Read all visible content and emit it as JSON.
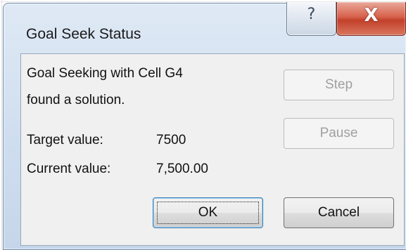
{
  "dialog": {
    "title": "Goal Seek Status",
    "caption_buttons": {
      "help_glyph": "?",
      "close_glyph": "X"
    },
    "message_line1": "Goal Seeking with Cell G4",
    "message_line2": "found a solution.",
    "target_label": "Target value:",
    "target_value": "7500",
    "current_label": "Current value:",
    "current_value": "7,500.00",
    "buttons": {
      "step": "Step",
      "pause": "Pause",
      "ok": "OK",
      "cancel": "Cancel"
    }
  },
  "colors": {
    "close_button": "#c2402b",
    "frame": "#cfdeef",
    "client": "#f0f0f0",
    "default_button_border": "#3c7fb1"
  }
}
